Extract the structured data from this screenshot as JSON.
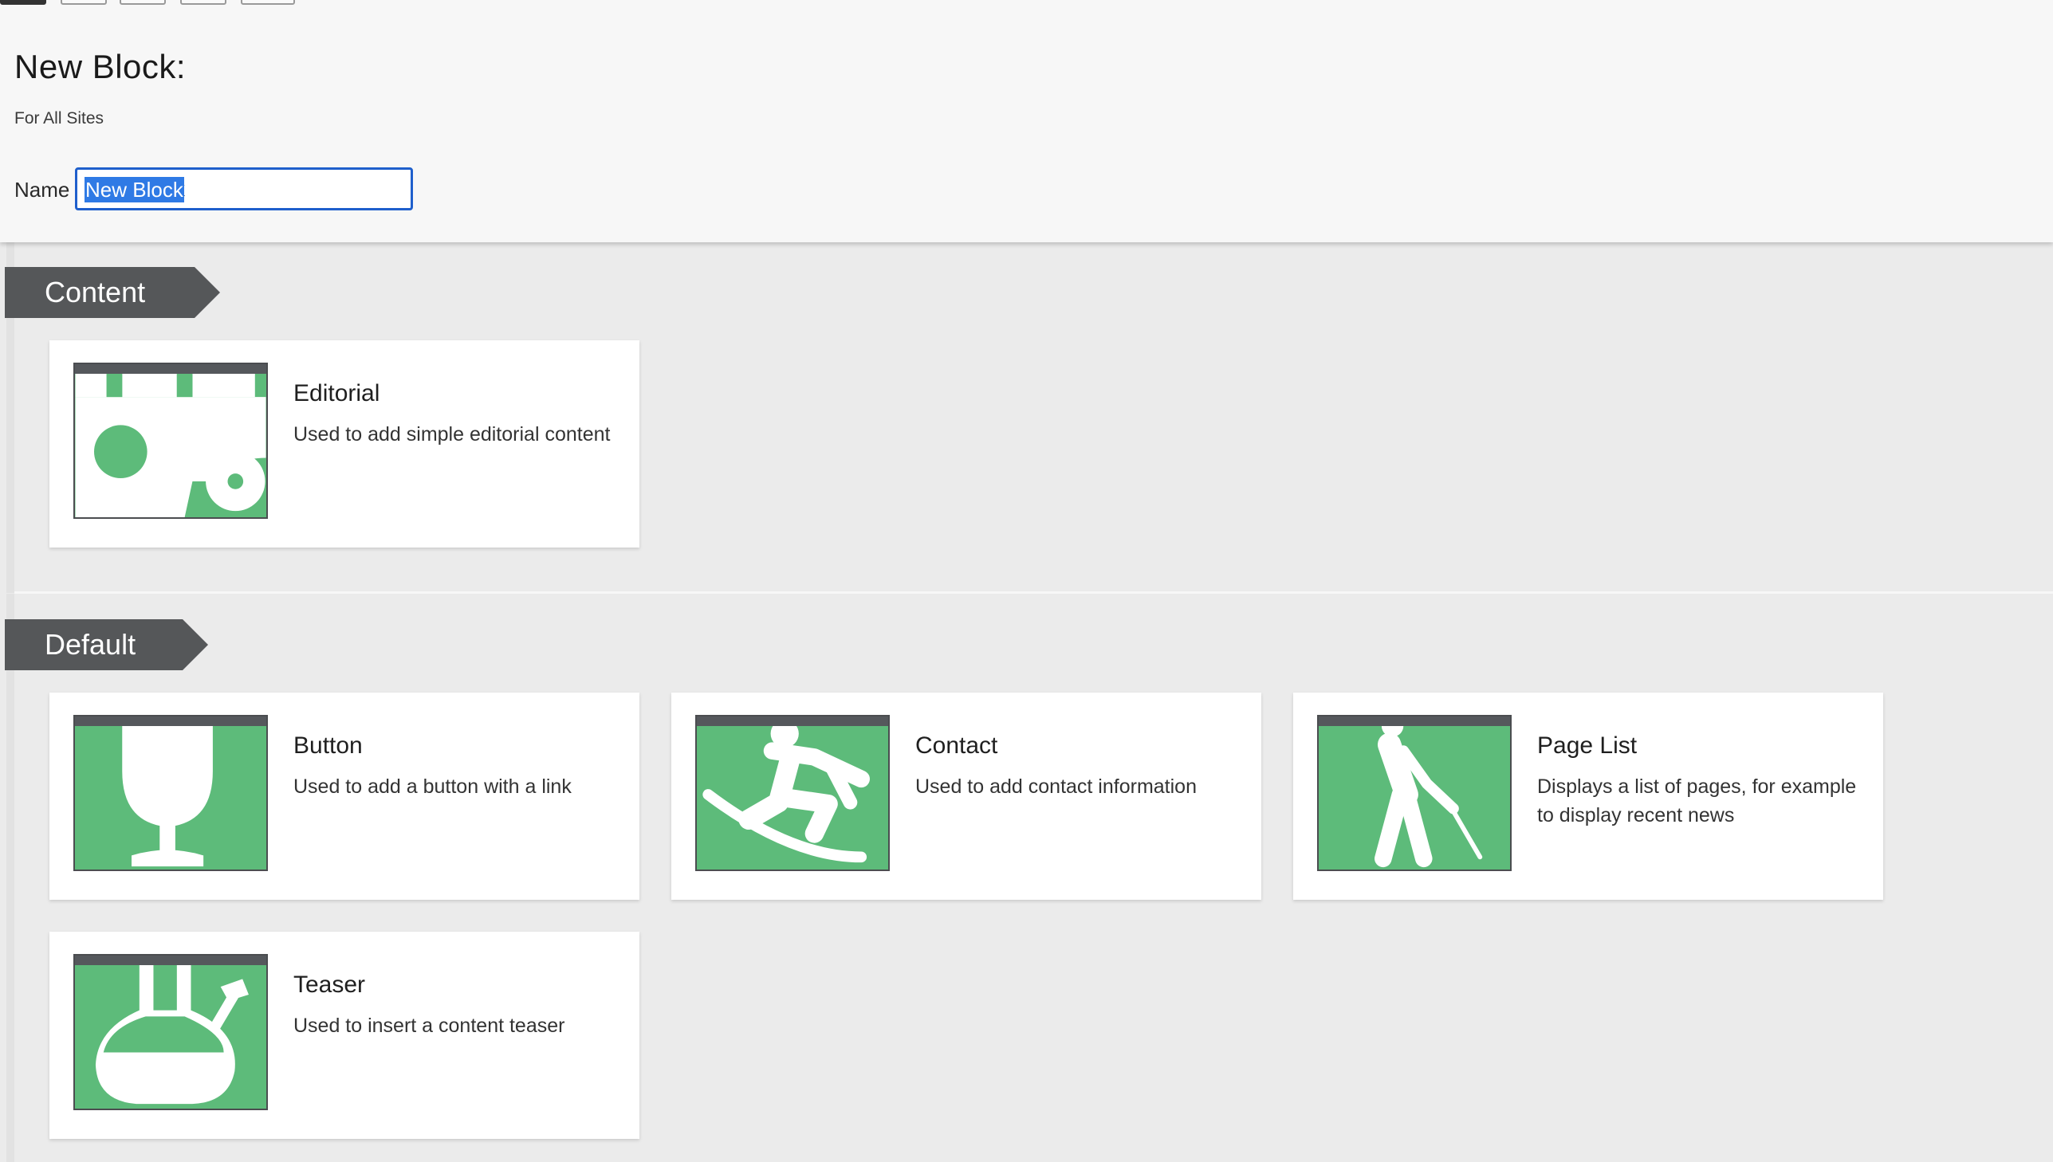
{
  "header": {
    "title": "New Block:",
    "subtitle": "For All Sites",
    "name_label": "Name",
    "name_value": "New Block"
  },
  "sections": [
    {
      "label": "Content",
      "blocks": [
        {
          "title": "Editorial",
          "description": "Used to add simple editorial content",
          "icon": "tractor-icon"
        }
      ]
    },
    {
      "label": "Default",
      "blocks": [
        {
          "title": "Button",
          "description": "Used to add a button with a link",
          "icon": "wine-glass-icon"
        },
        {
          "title": "Contact",
          "description": "Used to add contact information",
          "icon": "snowboarder-icon"
        },
        {
          "title": "Page List",
          "description": "Displays a list of pages, for example to display recent news",
          "icon": "blind-person-icon"
        },
        {
          "title": "Teaser",
          "description": "Used to insert a content teaser",
          "icon": "bong-icon"
        }
      ]
    }
  ],
  "colors": {
    "thumb_green": "#5dbb7a",
    "tag_gray": "#555759",
    "input_focus": "#1f5fcc",
    "selection": "#2f7ae5"
  }
}
